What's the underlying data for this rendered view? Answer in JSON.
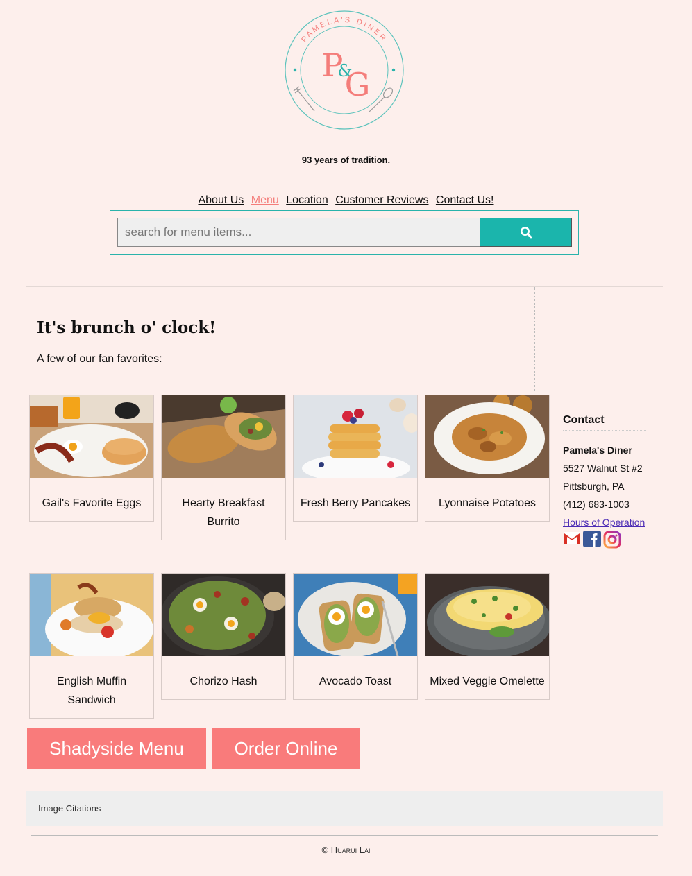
{
  "logo": {
    "ring_text": "PAMELA'S DINER",
    "monogram_first": "P",
    "monogram_amp": "&",
    "monogram_second": "G"
  },
  "tagline": "93 years of tradition.",
  "nav": [
    {
      "label": "About Us",
      "active": false
    },
    {
      "label": "Menu",
      "active": true
    },
    {
      "label": "Location",
      "active": false
    },
    {
      "label": "Customer Reviews",
      "active": false
    },
    {
      "label": "Contact Us!",
      "active": false
    }
  ],
  "search": {
    "placeholder": "search for menu items...",
    "value": "",
    "button_icon": "search-icon"
  },
  "main": {
    "headline": "It's brunch o' clock!",
    "subhead": "A few of our fan favorites:"
  },
  "menu_items": [
    {
      "label": "Gail's Favorite Eggs"
    },
    {
      "label": "Hearty Breakfast Burrito"
    },
    {
      "label": "Fresh Berry Pancakes"
    },
    {
      "label": "Lyonnaise Potatoes"
    },
    {
      "label": "English Muffin Sandwich"
    },
    {
      "label": "Chorizo Hash"
    },
    {
      "label": "Avocado Toast"
    },
    {
      "label": "Mixed Veggie Omelette"
    }
  ],
  "contact": {
    "title": "Contact",
    "name": "Pamela's Diner",
    "street": "5527 Walnut St #2",
    "city": "Pittsburgh, PA",
    "phone": "(412) 683-1003",
    "hours_link": "Hours of Operation",
    "social_icons": [
      "gmail-icon",
      "facebook-icon",
      "instagram-icon"
    ]
  },
  "buttons": {
    "menu": "Shadyside Menu",
    "order": "Order Online"
  },
  "citations": "Image Citations",
  "copyright": "© Huarui Lai",
  "colors": {
    "background": "#fdefec",
    "accent_teal": "#1bb5ac",
    "accent_coral": "#f97b7b",
    "link_purple": "#4b2bb5"
  }
}
